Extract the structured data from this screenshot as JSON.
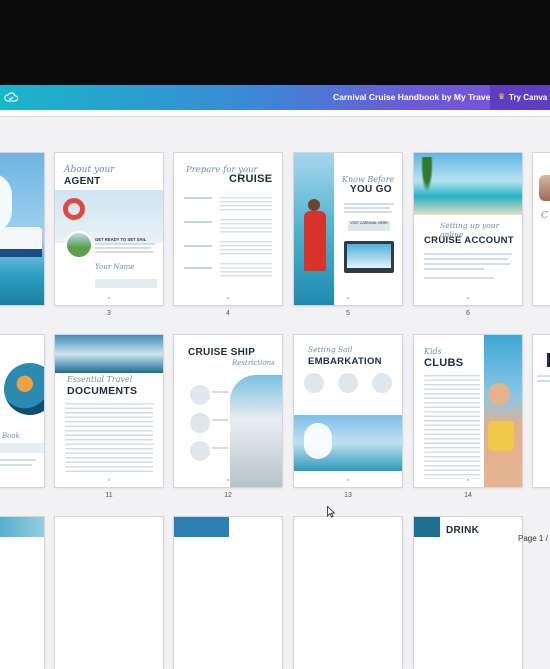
{
  "topbar": {
    "document_title": "Carnival Cruise Handbook by My Travel",
    "cta_label": "Try Canva f",
    "cloud_icon": "cloud-icon",
    "crown_icon": "crown-icon"
  },
  "colors": {
    "gradient_start": "#19b6c8",
    "gradient_end": "#7c4fd8",
    "cta_bg": "#5e3ec0"
  },
  "pages": {
    "row1": [
      {
        "number": "",
        "title": "",
        "script": ""
      },
      {
        "number": "3",
        "title": "AGENT",
        "script": "About your",
        "tagline": "GET READY TO SET SAIL",
        "sign": "Your Name"
      },
      {
        "number": "4",
        "title": "CRUISE",
        "script": "Prepare for your"
      },
      {
        "number": "5",
        "title": "YOU GO",
        "script": "Know Before",
        "button": "VISIT CARNIVAL HERE"
      },
      {
        "number": "6",
        "title": "CRUISE ACCOUNT",
        "script": "Setting up your online"
      },
      {
        "number": "",
        "title": "",
        "script": ""
      }
    ],
    "row2": [
      {
        "number": "",
        "title": "",
        "script": "Book"
      },
      {
        "number": "11",
        "title": "DOCUMENTS",
        "script": "Essential Travel"
      },
      {
        "number": "12",
        "title": "CRUISE SHIP",
        "script": "Restrictions"
      },
      {
        "number": "13",
        "title": "EMBARKATION",
        "script": "Setting Sail"
      },
      {
        "number": "14",
        "title": "CLUBS",
        "script": "Kids"
      },
      {
        "number": "",
        "title": "",
        "script": ""
      }
    ],
    "row3": [
      {
        "title": ""
      },
      {
        "title": ""
      },
      {
        "title": ""
      },
      {
        "title": ""
      },
      {
        "title": "DRINK"
      }
    ]
  },
  "footer": {
    "page_indicator": "Page 1 /"
  }
}
